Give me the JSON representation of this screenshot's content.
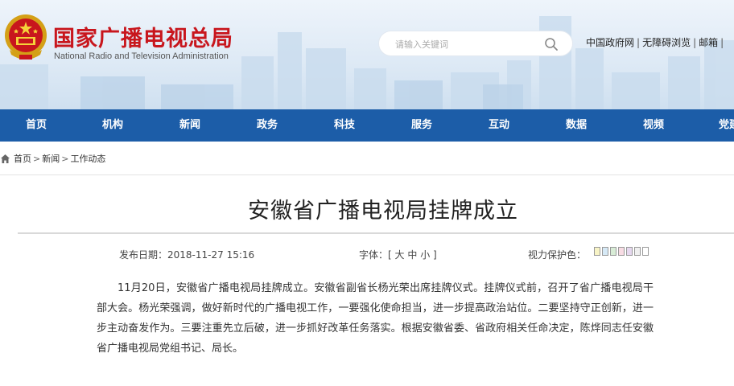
{
  "header": {
    "title": "国家广播电视总局",
    "subtitle": "National Radio and Television Administration",
    "search": {
      "placeholder": "请输入关键词",
      "value": ""
    },
    "links": [
      {
        "label": "中国政府网"
      },
      {
        "label": "无障碍浏览"
      },
      {
        "label": "邮箱"
      }
    ]
  },
  "nav": {
    "items": [
      {
        "label": "首页"
      },
      {
        "label": "机构"
      },
      {
        "label": "新闻"
      },
      {
        "label": "政务"
      },
      {
        "label": "科技"
      },
      {
        "label": "服务"
      },
      {
        "label": "互动"
      },
      {
        "label": "数据"
      },
      {
        "label": "视频"
      },
      {
        "label": "党建"
      }
    ]
  },
  "breadcrumb": {
    "items": [
      {
        "label": "首页"
      },
      {
        "label": "新闻"
      },
      {
        "label": "工作动态"
      }
    ],
    "separator": ">"
  },
  "article": {
    "title": "安徽省广播电视局挂牌成立",
    "meta": {
      "date_label": "发布日期：",
      "date_value": "2018-11-27 15:16",
      "font_label": "字体：",
      "font_open": "[ ",
      "font_large": "大",
      "font_medium": "中",
      "font_small": "小",
      "font_close": " ]",
      "eye_label": "视力保护色："
    },
    "eye_colors": [
      "#f8f4c6",
      "#d6e9f6",
      "#d8ecd6",
      "#f8dce4",
      "#e6d8ef",
      "#f0f0f0",
      "#ffffff"
    ],
    "body": "11月20日，安徽省广播电视局挂牌成立。安徽省副省长杨光荣出席挂牌仪式。挂牌仪式前，召开了省广播电视局干部大会。杨光荣强调，做好新时代的广播电视工作，一要强化使命担当，进一步提高政治站位。二要坚持守正创新，进一步主动奋发作为。三要注重先立后破，进一步抓好改革任务落实。根据安徽省委、省政府相关任命决定，陈烨同志任安徽省广播电视局党组书记、局长。"
  },
  "colors": {
    "brand_red": "#c8161d",
    "nav_blue": "#1c5da8"
  }
}
